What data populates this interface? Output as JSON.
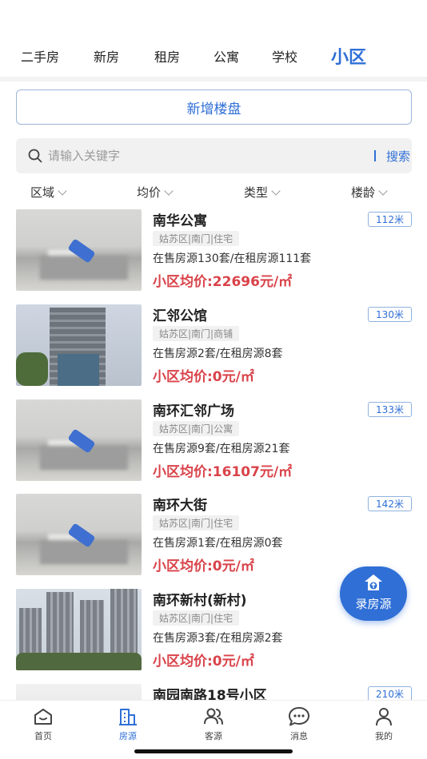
{
  "top_tabs": [
    "二手房",
    "新房",
    "租房",
    "公寓",
    "学校",
    "小区"
  ],
  "add_button": "新增楼盘",
  "search": {
    "placeholder": "请输入关键字",
    "button": "搜索"
  },
  "filters": [
    "区域",
    "均价",
    "类型",
    "楼龄"
  ],
  "listings": [
    {
      "title": "南华公寓",
      "distance": "112米",
      "tags": "姑苏区|南门|住宅",
      "stock": "在售房源130套/在租房源111套",
      "price": "小区均价:22696元/㎡"
    },
    {
      "title": "汇邻公馆",
      "distance": "130米",
      "tags": "姑苏区|南门|商铺",
      "stock": "在售房源2套/在租房源8套",
      "price": "小区均价:0元/㎡"
    },
    {
      "title": "南环汇邻广场",
      "distance": "133米",
      "tags": "姑苏区|南门|公寓",
      "stock": "在售房源9套/在租房源21套",
      "price": "小区均价:16107元/㎡"
    },
    {
      "title": "南环大街",
      "distance": "142米",
      "tags": "姑苏区|南门|住宅",
      "stock": "在售房源1套/在租房源0套",
      "price": "小区均价:0元/㎡"
    },
    {
      "title": "南环新村(新村)",
      "distance": "",
      "tags": "姑苏区|南门|住宅",
      "stock": "在售房源3套/在租房源2套",
      "price": "小区均价:0元/㎡"
    },
    {
      "title": "南园南路18号小区",
      "distance": "210米"
    }
  ],
  "fab": {
    "label": "录房源",
    "icon": "house-upload-icon"
  },
  "bottom_nav": [
    {
      "label": "首页",
      "icon": "home-icon"
    },
    {
      "label": "房源",
      "icon": "building-icon"
    },
    {
      "label": "客源",
      "icon": "users-icon"
    },
    {
      "label": "消息",
      "icon": "chat-icon"
    },
    {
      "label": "我的",
      "icon": "profile-icon"
    }
  ],
  "colors": {
    "accent": "#2f6fd6",
    "price": "#d9434a"
  }
}
